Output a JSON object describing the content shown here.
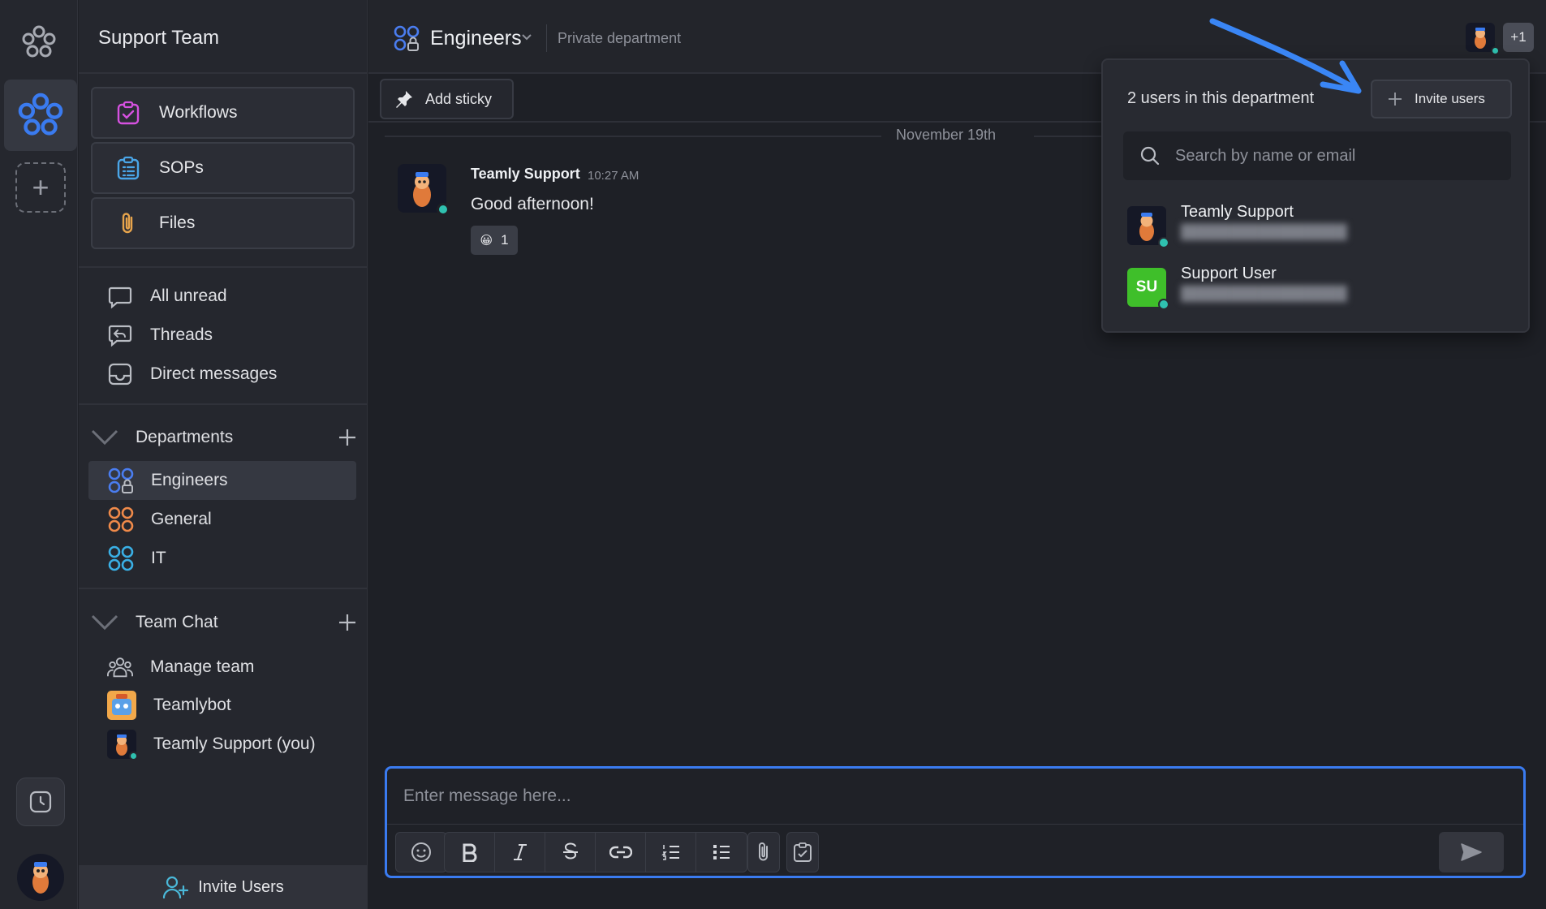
{
  "workspace": {
    "name": "Support Team"
  },
  "sidebar": {
    "cards": [
      {
        "label": "Workflows",
        "icon": "workflow-checklist-icon",
        "color": "#d651e0"
      },
      {
        "label": "SOPs",
        "icon": "clipboard-list-icon",
        "color": "#4aa6e8"
      },
      {
        "label": "Files",
        "icon": "paperclip-icon",
        "color": "#e7a44c"
      }
    ],
    "nav": [
      {
        "label": "All unread",
        "icon": "chat-bubble-icon"
      },
      {
        "label": "Threads",
        "icon": "threads-icon"
      },
      {
        "label": "Direct messages",
        "icon": "inbox-icon"
      }
    ],
    "departments": {
      "title": "Departments",
      "items": [
        {
          "label": "Engineers",
          "icon": "private-department-icon",
          "color": "#4a7df0",
          "active": true
        },
        {
          "label": "General",
          "icon": "department-icon",
          "color": "#f08a4a"
        },
        {
          "label": "IT",
          "icon": "department-icon",
          "color": "#3ab0e6"
        }
      ]
    },
    "team_chat": {
      "title": "Team Chat",
      "items": [
        {
          "label": "Manage team",
          "icon": "team-people-icon"
        },
        {
          "label": "Teamlybot",
          "icon": "teamlybot-avatar"
        },
        {
          "label": "Teamly Support (you)",
          "icon": "support-avatar"
        }
      ]
    },
    "invite_label": "Invite Users"
  },
  "channel": {
    "name": "Engineers",
    "description": "Private department",
    "extra_members": "+1"
  },
  "toolbar": {
    "add_sticky": "Add sticky"
  },
  "messages": {
    "date_divider": "November 19th",
    "items": [
      {
        "author": "Teamly Support",
        "time": "10:27 AM",
        "text": "Good afternoon!",
        "reaction_emoji": "😀",
        "reaction_count": "1"
      }
    ]
  },
  "composer": {
    "placeholder": "Enter message here...",
    "tools": [
      "emoji-icon",
      "bold-icon",
      "italic-icon",
      "strikethrough-icon",
      "link-icon",
      "ordered-list-icon",
      "bullet-list-icon",
      "attach-icon",
      "task-icon"
    ]
  },
  "popover": {
    "title": "2 users in this department",
    "invite_label": "Invite users",
    "search_placeholder": "Search by name or email",
    "users": [
      {
        "name": "Teamly Support",
        "avatar": "support-avatar"
      },
      {
        "name": "Support User",
        "initials": "SU",
        "avatar_color": "#3fbf2a"
      }
    ]
  },
  "colors": {
    "accent": "#3a7bf0",
    "online": "#2fc1b0",
    "annotation_arrow": "#3a86f5"
  }
}
